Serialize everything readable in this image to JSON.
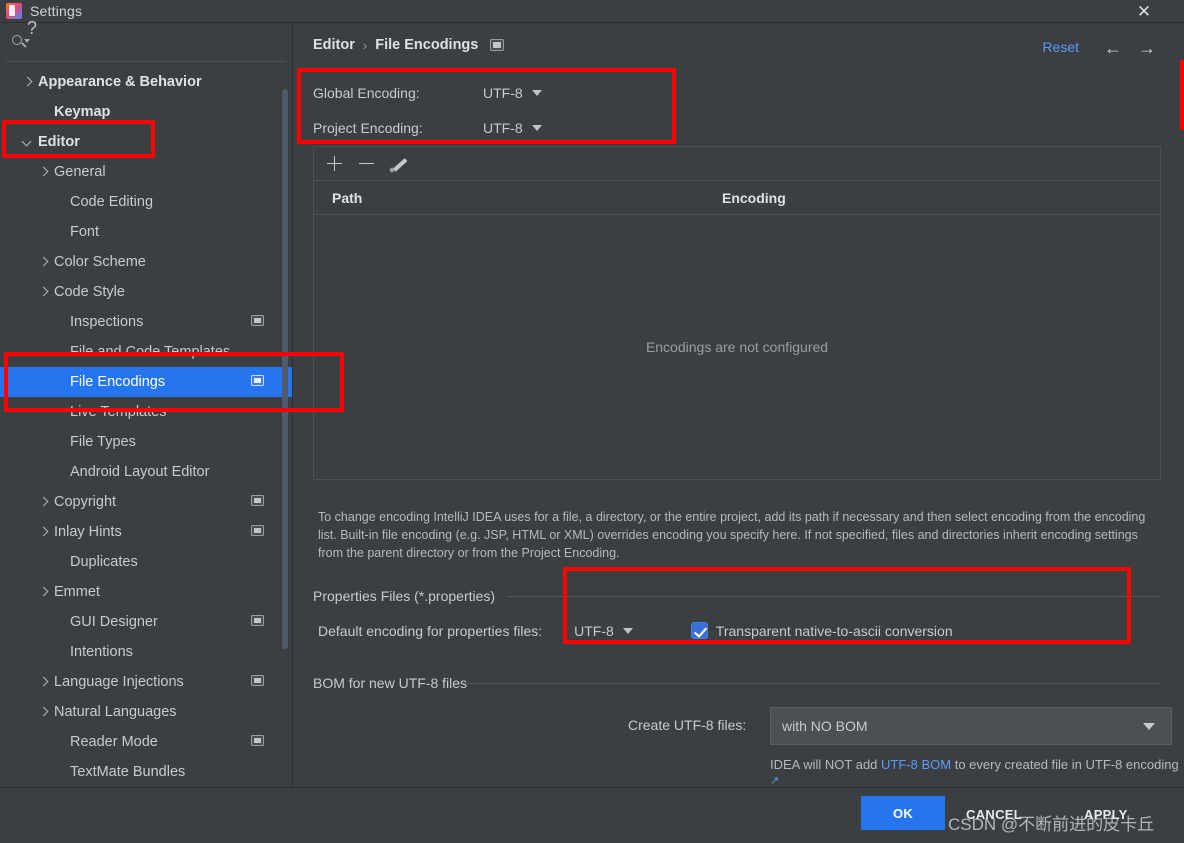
{
  "window": {
    "title": "Settings",
    "app_icon": "intellij-idea-icon",
    "close_icon": "close-icon"
  },
  "sidebar": {
    "search": {
      "placeholder": "",
      "value": "",
      "icon": "search-icon"
    },
    "items": [
      {
        "label": "Appearance & Behavior",
        "indent": 0,
        "twisty": "right",
        "bold": true,
        "badge": false,
        "selected": false
      },
      {
        "label": "Keymap",
        "indent": 1,
        "twisty": "none",
        "bold": true,
        "badge": false,
        "selected": false
      },
      {
        "label": "Editor",
        "indent": 0,
        "twisty": "down",
        "bold": true,
        "badge": false,
        "selected": false
      },
      {
        "label": "General",
        "indent": 1,
        "twisty": "right",
        "bold": false,
        "badge": false,
        "selected": false
      },
      {
        "label": "Code Editing",
        "indent": 2,
        "twisty": "none",
        "bold": false,
        "badge": false,
        "selected": false
      },
      {
        "label": "Font",
        "indent": 2,
        "twisty": "none",
        "bold": false,
        "badge": false,
        "selected": false
      },
      {
        "label": "Color Scheme",
        "indent": 1,
        "twisty": "right",
        "bold": false,
        "badge": false,
        "selected": false
      },
      {
        "label": "Code Style",
        "indent": 1,
        "twisty": "right",
        "bold": false,
        "badge": false,
        "selected": false
      },
      {
        "label": "Inspections",
        "indent": 2,
        "twisty": "none",
        "bold": false,
        "badge": true,
        "selected": false
      },
      {
        "label": "File and Code Templates",
        "indent": 2,
        "twisty": "none",
        "bold": false,
        "badge": false,
        "selected": false
      },
      {
        "label": "File Encodings",
        "indent": 2,
        "twisty": "none",
        "bold": false,
        "badge": true,
        "selected": true
      },
      {
        "label": "Live Templates",
        "indent": 2,
        "twisty": "none",
        "bold": false,
        "badge": false,
        "selected": false
      },
      {
        "label": "File Types",
        "indent": 2,
        "twisty": "none",
        "bold": false,
        "badge": false,
        "selected": false
      },
      {
        "label": "Android Layout Editor",
        "indent": 2,
        "twisty": "none",
        "bold": false,
        "badge": false,
        "selected": false
      },
      {
        "label": "Copyright",
        "indent": 1,
        "twisty": "right",
        "bold": false,
        "badge": true,
        "selected": false
      },
      {
        "label": "Inlay Hints",
        "indent": 1,
        "twisty": "right",
        "bold": false,
        "badge": true,
        "selected": false
      },
      {
        "label": "Duplicates",
        "indent": 2,
        "twisty": "none",
        "bold": false,
        "badge": false,
        "selected": false
      },
      {
        "label": "Emmet",
        "indent": 1,
        "twisty": "right",
        "bold": false,
        "badge": false,
        "selected": false
      },
      {
        "label": "GUI Designer",
        "indent": 2,
        "twisty": "none",
        "bold": false,
        "badge": true,
        "selected": false
      },
      {
        "label": "Intentions",
        "indent": 2,
        "twisty": "none",
        "bold": false,
        "badge": false,
        "selected": false
      },
      {
        "label": "Language Injections",
        "indent": 1,
        "twisty": "right",
        "bold": false,
        "badge": true,
        "selected": false
      },
      {
        "label": "Natural Languages",
        "indent": 1,
        "twisty": "right",
        "bold": false,
        "badge": false,
        "selected": false
      },
      {
        "label": "Reader Mode",
        "indent": 2,
        "twisty": "none",
        "bold": false,
        "badge": true,
        "selected": false
      },
      {
        "label": "TextMate Bundles",
        "indent": 2,
        "twisty": "none",
        "bold": false,
        "badge": false,
        "selected": false
      }
    ]
  },
  "header": {
    "crumb_parent": "Editor",
    "crumb_sep": "›",
    "crumb_current": "File Encodings",
    "project_badge_icon": "project-settings-icon",
    "reset_label": "Reset",
    "back_icon": "arrow-left-icon",
    "forward_icon": "arrow-right-icon"
  },
  "encodings": {
    "global_label": "Global Encoding:",
    "global_value": "UTF-8",
    "project_label": "Project Encoding:",
    "project_value": "UTF-8"
  },
  "table": {
    "toolbar": {
      "add_icon": "plus-icon",
      "remove_icon": "minus-icon",
      "edit_icon": "pencil-icon"
    },
    "columns": [
      "Path",
      "Encoding"
    ],
    "rows": [],
    "empty_text": "Encodings are not configured"
  },
  "description": "To change encoding IntelliJ IDEA uses for a file, a directory, or the entire project, add its path if necessary and then select encoding from the encoding list. Built-in file encoding (e.g. JSP, HTML or XML) overrides encoding you specify here. If not specified, files and directories inherit encoding settings from the parent directory or from the Project Encoding.",
  "properties_section": {
    "title": "Properties Files (*.properties)",
    "default_encoding_label": "Default encoding for properties files:",
    "default_encoding_value": "UTF-8",
    "transparent_checkbox_label": "Transparent native-to-ascii conversion",
    "transparent_checked": true
  },
  "bom_section": {
    "title": "BOM for new UTF-8 files",
    "create_label": "Create UTF-8 files:",
    "create_value": "with NO BOM",
    "note_prefix": "IDEA will NOT add ",
    "note_link": "UTF-8 BOM",
    "note_suffix": " to every created file in UTF-8 encoding",
    "note_external_icon": "↗"
  },
  "footer": {
    "help_label": "?",
    "ok_label": "OK",
    "cancel_label": "CANCEL",
    "apply_label": "APPLY"
  },
  "watermark": "CSDN @不断前进的皮卡丘",
  "colors": {
    "accent_blue": "#2675f0",
    "link_blue": "#5b9bf8",
    "annotation_red": "#ff0000",
    "panel_bg": "#3c3f41"
  }
}
